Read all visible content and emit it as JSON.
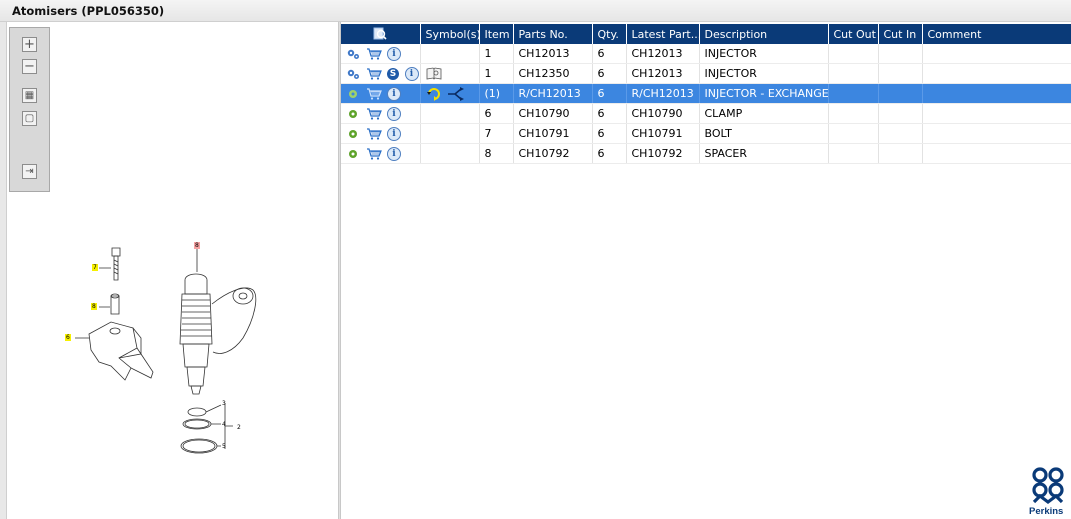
{
  "window": {
    "title": "Atomisers (PPL056350)"
  },
  "drawing_toolbar": {
    "buttons": [
      {
        "name": "zoom-in-button",
        "glyph": "+"
      },
      {
        "name": "zoom-out-button",
        "glyph": "−"
      },
      {
        "name": "fit-all-button",
        "glyph": "▦"
      },
      {
        "name": "fit-page-button",
        "glyph": "▢"
      },
      {
        "name": "export-button",
        "glyph": "⇥"
      }
    ]
  },
  "drawing": {
    "callouts": [
      {
        "label": "8",
        "highlight": "red"
      },
      {
        "label": "7",
        "highlight": "yellow"
      },
      {
        "label": "8",
        "highlight": "yellow"
      },
      {
        "label": "6",
        "highlight": "yellow"
      },
      {
        "label": "3",
        "highlight": "none"
      },
      {
        "label": "4",
        "highlight": "none"
      },
      {
        "label": "2",
        "highlight": "none"
      },
      {
        "label": "5",
        "highlight": "none"
      }
    ]
  },
  "grid": {
    "columns": [
      "",
      "Symbol(s)",
      "Item",
      "Parts No.",
      "Qty.",
      "Latest Part...",
      "Description",
      "Cut Out",
      "Cut In",
      "Comment"
    ],
    "rows": [
      {
        "icons": [
          "gears-icon",
          "cart-icon",
          "info-icon"
        ],
        "symbols": [],
        "item": "1",
        "part_no": "CH12013",
        "qty": "6",
        "latest": "CH12013",
        "description": "INJECTOR",
        "cut_out": "",
        "cut_in": "",
        "comment": "",
        "selected": false
      },
      {
        "icons": [
          "gears-icon",
          "cart-icon",
          "s-badge-icon",
          "info-icon"
        ],
        "symbols": [
          "book-icon"
        ],
        "item": "1",
        "part_no": "CH12350",
        "qty": "6",
        "latest": "CH12013",
        "description": "INJECTOR",
        "cut_out": "",
        "cut_in": "",
        "comment": "",
        "selected": false
      },
      {
        "icons": [
          "gear-icon",
          "cart-icon",
          "info-icon"
        ],
        "symbols": [
          "exchange-icon",
          "branch-icon"
        ],
        "item": "(1)",
        "part_no": "R/CH12013",
        "qty": "6",
        "latest": "R/CH12013",
        "description": "INJECTOR - EXCHANGE",
        "cut_out": "",
        "cut_in": "",
        "comment": "",
        "selected": true
      },
      {
        "icons": [
          "gear-icon",
          "cart-icon",
          "info-icon"
        ],
        "symbols": [],
        "item": "6",
        "part_no": "CH10790",
        "qty": "6",
        "latest": "CH10790",
        "description": "CLAMP",
        "cut_out": "",
        "cut_in": "",
        "comment": "",
        "selected": false
      },
      {
        "icons": [
          "gear-icon",
          "cart-icon",
          "info-icon"
        ],
        "symbols": [],
        "item": "7",
        "part_no": "CH10791",
        "qty": "6",
        "latest": "CH10791",
        "description": "BOLT",
        "cut_out": "",
        "cut_in": "",
        "comment": "",
        "selected": false
      },
      {
        "icons": [
          "gear-icon",
          "cart-icon",
          "info-icon"
        ],
        "symbols": [],
        "item": "8",
        "part_no": "CH10792",
        "qty": "6",
        "latest": "CH10792",
        "description": "SPACER",
        "cut_out": "",
        "cut_in": "",
        "comment": "",
        "selected": false
      }
    ]
  },
  "brand": {
    "name": "Perkins",
    "color": "#0a3a78"
  },
  "colors": {
    "header_bg": "#0a3a78",
    "selected_row": "#3c86e0",
    "callout_yellow": "#f6f000",
    "callout_red": "#f7a3a3"
  }
}
